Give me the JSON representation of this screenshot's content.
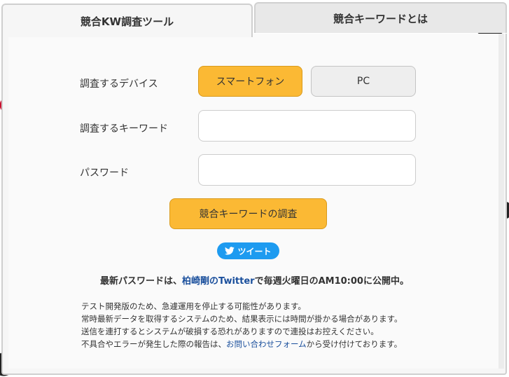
{
  "tabs": {
    "tool": "競合KW調査ツール",
    "about": "競合キーワードとは"
  },
  "form": {
    "device_label": "調査するデバイス",
    "device_smartphone": "スマートフォン",
    "device_pc": "PC",
    "device_selected": "スマートフォン",
    "keyword_label": "調査するキーワード",
    "keyword_value": "",
    "password_label": "パスワード",
    "password_value": "",
    "submit_label": "競合キーワードの調査"
  },
  "tweet": {
    "label": "ツイート",
    "icon": "twitter-bird-icon"
  },
  "notice": {
    "prefix": "最新パスワードは、",
    "link": "柏崎剛のTwitter",
    "suffix": "で毎週火曜日のAM10:00に公開中。"
  },
  "info": {
    "line1": "テスト開発版のため、急遽運用を停止する可能性があります。",
    "line2": "常時最新データを取得するシステムのため、結果表示には時間が掛かる場合があります。",
    "line3": "送信を連打するとシステムが破損する恐れがありますので連投はお控えください。",
    "line4_prefix": "不具合やエラーが発生した際の報告は、",
    "line4_link": "お問い合わせフォーム",
    "line4_suffix": "から受け付けております。"
  },
  "colors": {
    "accent": "#fbb934",
    "link": "#1a4f9c",
    "tweet": "#1d9bf0"
  }
}
